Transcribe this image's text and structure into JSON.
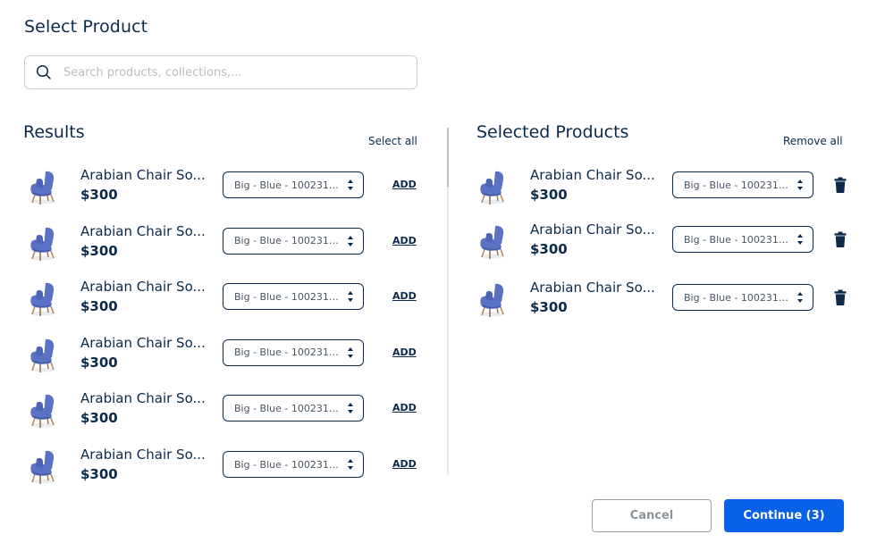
{
  "header": {
    "title": "Select Product"
  },
  "search": {
    "placeholder": "Search products, collections,..."
  },
  "results": {
    "title": "Results",
    "select_all_label": "Select all",
    "items": [
      {
        "name": "Arabian Chair So...",
        "price": "$300",
        "variant": "Big - Blue - 1002312...",
        "action": "ADD"
      },
      {
        "name": "Arabian Chair So...",
        "price": "$300",
        "variant": "Big - Blue - 1002312...",
        "action": "ADD"
      },
      {
        "name": "Arabian Chair So...",
        "price": "$300",
        "variant": "Big - Blue - 1002312...",
        "action": "ADD"
      },
      {
        "name": "Arabian Chair So...",
        "price": "$300",
        "variant": "Big - Blue - 1002312...",
        "action": "ADD"
      },
      {
        "name": "Arabian Chair So...",
        "price": "$300",
        "variant": "Big - Blue - 1002312...",
        "action": "ADD"
      },
      {
        "name": "Arabian Chair So...",
        "price": "$300",
        "variant": "Big - Blue - 1002312...",
        "action": "ADD"
      }
    ]
  },
  "selected": {
    "title": "Selected Products",
    "remove_all_label": "Remove all",
    "items": [
      {
        "name": "Arabian Chair So...",
        "price": "$300",
        "variant": "Big - Blue - 1002312..."
      },
      {
        "name": "Arabian Chair So...",
        "price": "$300",
        "variant": "Big - Blue - 1002312..."
      },
      {
        "name": "Arabian Chair So...",
        "price": "$300",
        "variant": "Big - Blue - 1002312..."
      }
    ]
  },
  "footer": {
    "cancel_label": "Cancel",
    "continue_label": "Continue (3)"
  },
  "icons": {
    "search": "search-icon",
    "chair": "chair-icon",
    "select_arrows": "updown-arrows-icon",
    "trash": "trash-icon"
  },
  "colors": {
    "primary": "#0a60e6",
    "text": "#0b2a4a",
    "chair": "#5b72c4"
  }
}
